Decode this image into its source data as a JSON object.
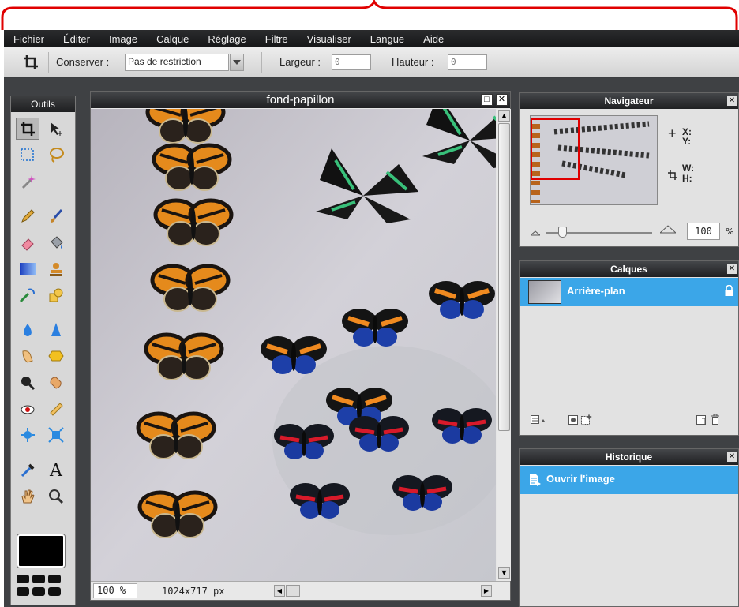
{
  "app": {
    "menu": [
      "Fichier",
      "Éditer",
      "Image",
      "Calque",
      "Réglage",
      "Filtre",
      "Visualiser",
      "Langue",
      "Aide"
    ]
  },
  "options_bar": {
    "conserver_label": "Conserver :",
    "conserver_value": "Pas de restriction",
    "largeur_label": "Largeur :",
    "largeur_value": "0",
    "hauteur_label": "Hauteur :",
    "hauteur_value": "0"
  },
  "tools_panel": {
    "title": "Outils",
    "tools": [
      "crop-icon",
      "move-icon",
      "marquee-icon",
      "lasso-icon",
      "magic-wand-icon",
      "pencil-icon",
      "brush-icon",
      "eraser-icon",
      "bucket-icon",
      "gradient-icon",
      "stamp-icon",
      "color-replace-icon",
      "shape-icon",
      "drop-icon",
      "sharpen-icon",
      "smudge-icon",
      "sponge-icon",
      "dodge-icon",
      "burn-icon",
      "red-eye-icon",
      "spot-heal-icon",
      "bloat-icon",
      "pinch-icon",
      "color-picker-icon",
      "type-icon",
      "hand-icon",
      "zoom-icon"
    ],
    "foreground_color": "#000000"
  },
  "image_window": {
    "title": "fond-papillon",
    "zoom": "100 %",
    "size": "1024x717 px"
  },
  "navigator": {
    "title": "Navigateur",
    "x_label": "X:",
    "y_label": "Y:",
    "w_label": "W:",
    "h_label": "H:",
    "zoom_value": "100",
    "zoom_unit": "%",
    "zoom_fraction": 0.15
  },
  "layers": {
    "title": "Calques",
    "items": [
      {
        "name": "Arrière-plan",
        "locked": true
      }
    ]
  },
  "history": {
    "title": "Historique",
    "items": [
      "Ouvrir l'image"
    ]
  },
  "colors": {
    "accent": "#3ba6e8",
    "highlight": "#e00000"
  }
}
